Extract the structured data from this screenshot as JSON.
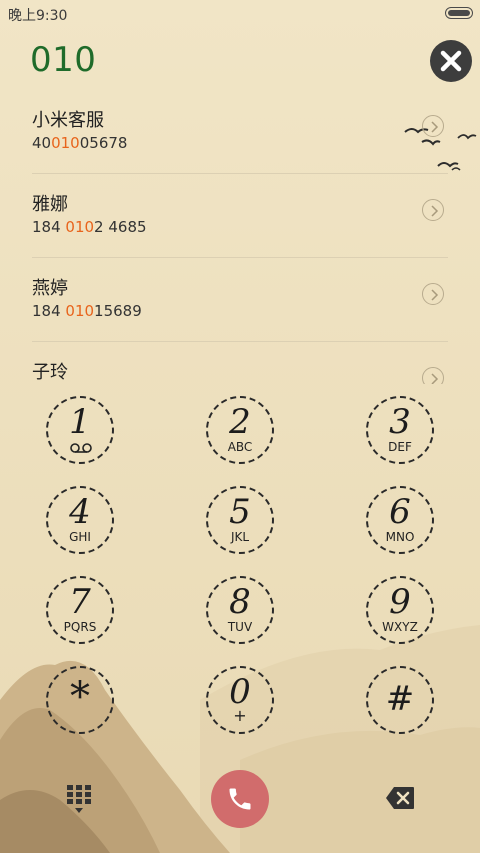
{
  "status_bar": {
    "time": "晚上9:30"
  },
  "dial": {
    "number": "010"
  },
  "results": [
    {
      "name": "小米客服",
      "num_pre": "40",
      "num_match": "010",
      "num_post": "05678"
    },
    {
      "name": "雅娜",
      "num_pre": "184 ",
      "num_match": "010",
      "num_post": "2 4685"
    },
    {
      "name": "燕婷",
      "num_pre": "184 ",
      "num_match": "010",
      "num_post": "15689"
    },
    {
      "name": "子玲",
      "num_pre": "",
      "num_match": "",
      "num_post": ""
    }
  ],
  "keypad": [
    {
      "digit": "1",
      "sub": ""
    },
    {
      "digit": "2",
      "sub": "ABC"
    },
    {
      "digit": "3",
      "sub": "DEF"
    },
    {
      "digit": "4",
      "sub": "GHI"
    },
    {
      "digit": "5",
      "sub": "JKL"
    },
    {
      "digit": "6",
      "sub": "MNO"
    },
    {
      "digit": "7",
      "sub": "PQRS"
    },
    {
      "digit": "8",
      "sub": "TUV"
    },
    {
      "digit": "9",
      "sub": "WXYZ"
    },
    {
      "digit": "*",
      "sub": ""
    },
    {
      "digit": "0",
      "sub": "+"
    },
    {
      "digit": "#",
      "sub": ""
    }
  ],
  "colors": {
    "highlight": "#e8641c",
    "call_button": "#d16c6c",
    "dialed_number": "#1f6b2a"
  },
  "icons": {
    "close": "close-icon",
    "dialpad": "dialpad-grid-icon",
    "call": "phone-icon",
    "backspace": "backspace-icon",
    "voicemail": "voicemail-icon",
    "chevron": "chevron-right-icon"
  }
}
